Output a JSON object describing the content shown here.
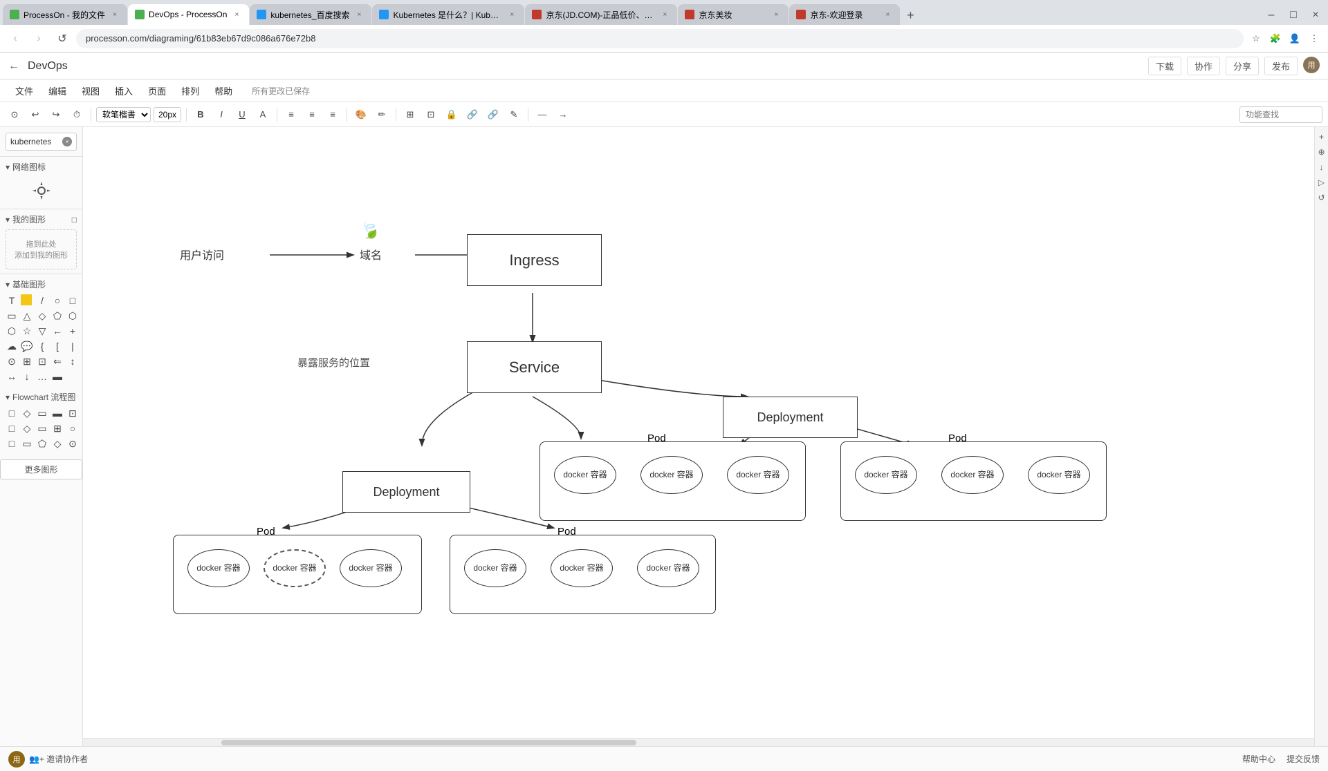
{
  "browser": {
    "tabs": [
      {
        "id": "t1",
        "label": "ProcessOn - 我的文件",
        "favicon_color": "#4CAF50",
        "active": false
      },
      {
        "id": "t2",
        "label": "DevOps - ProcessOn",
        "favicon_color": "#4CAF50",
        "active": true
      },
      {
        "id": "t3",
        "label": "kubernetes_百度搜索",
        "favicon_color": "#2196F3",
        "active": false
      },
      {
        "id": "t4",
        "label": "Kubernetes 是什么？| Kubern...",
        "favicon_color": "#2196F3",
        "active": false
      },
      {
        "id": "t5",
        "label": "京东(JD.COM)-正品低价、品质...",
        "favicon_color": "#C0392B",
        "active": false
      },
      {
        "id": "t6",
        "label": "京东美妆",
        "favicon_color": "#C0392B",
        "active": false
      },
      {
        "id": "t7",
        "label": "京东-欢迎登录",
        "favicon_color": "#C0392B",
        "active": false
      }
    ],
    "url": "processon.com/diagraming/61b83eb67d9c086a676e72b8",
    "close_tab_symbol": "×"
  },
  "app": {
    "back_icon": "←",
    "title": "DevOps"
  },
  "menu": {
    "items": [
      "文件",
      "编辑",
      "视图",
      "插入",
      "页面",
      "排列",
      "帮助"
    ],
    "save_status": "所有更改已保存"
  },
  "toolbar": {
    "undo": "↩",
    "redo": "↪",
    "font_name": "软笔楷書",
    "font_size": "20px",
    "bold": "B",
    "italic": "I",
    "underline": "U",
    "search_placeholder": "功能查找",
    "download_label": "下载",
    "collaborate_label": "协作",
    "share_label": "分享",
    "publish_label": "发布"
  },
  "sidebar": {
    "search_text": "kubernetes",
    "network_icons_label": "网络图标",
    "my_shapes_label": "我的图形",
    "drop_text": "拖到此处\n添加到我的图形",
    "basic_shapes_label": "基础图形",
    "flowchart_label": "Flowchart 流程图",
    "more_shapes_label": "更多图形"
  },
  "diagram": {
    "user_access_label": "用户访问",
    "domain_label": "域名",
    "expose_label": "暴露服务的位置",
    "ingress_label": "Ingress",
    "service_label": "Service",
    "deployment1_label": "Deployment",
    "deployment2_label": "Deployment",
    "pod1_label": "Pod",
    "pod2_label": "Pod",
    "pod3_label": "Pod",
    "docker_label": "docker\n容器"
  },
  "status_bar": {
    "avatar_text": "用",
    "invite_label": "👥+ 邀请协作者",
    "help_label": "帮助中心",
    "feedback_label": "提交反馈"
  }
}
